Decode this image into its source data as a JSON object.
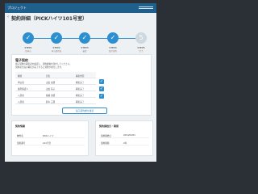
{
  "header": {
    "logo": "プロジェクト",
    "page_title": "契約詳細（PICKハイツ101号室）"
  },
  "steps": [
    {
      "num": "✓",
      "label": "STEP1",
      "sub": "仮申込",
      "active": true
    },
    {
      "num": "✓",
      "label": "STEP2",
      "sub": "申込書提出",
      "active": true
    },
    {
      "num": "✓",
      "label": "STEP3",
      "sub": "審査",
      "active": true
    },
    {
      "num": "✓",
      "label": "STEP4",
      "sub": "電子契約",
      "active": true
    },
    {
      "num": "5",
      "label": "STEP5",
      "sub": "完了",
      "active": false
    }
  ],
  "main": {
    "section_title": "電子契約",
    "paragraph1": "電子契約の署名者を確認し、契約書類を送付してください。",
    "paragraph2": "契約者全員の署名が完了すると契約が成立します。",
    "table": {
      "columns": [
        "種別",
        "氏名",
        "署名状況"
      ],
      "rows": [
        [
          "申込者",
          "山田 太郎",
          "署名完了"
        ],
        [
          "連帯保証人",
          "山田 花子",
          "署名完了"
        ],
        [
          "入居者",
          "佐藤 次郎",
          "署名完了"
        ],
        [
          "入居者",
          "鈴木 三郎",
          "署名完了"
        ]
      ]
    },
    "button_label": "電子契約書を確認"
  },
  "bottom_left": {
    "title": "契約情報",
    "rows": [
      [
        "物件名",
        "PICKハイツ"
      ],
      [
        "部屋番号",
        "101号室"
      ]
    ]
  },
  "bottom_right": {
    "title": "契約開始日・期間",
    "rows": [
      [
        "契約開始日",
        "2024/04/01"
      ],
      [
        "契約期間",
        "2年"
      ]
    ]
  }
}
